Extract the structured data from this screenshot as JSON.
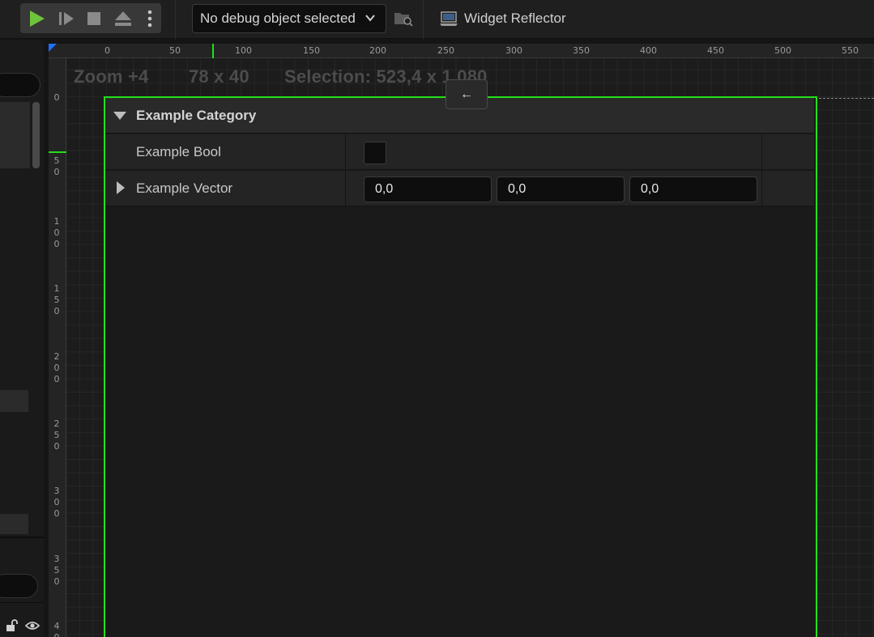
{
  "toolbar": {
    "play_icon": "play-icon",
    "step_icon": "step-forward-icon",
    "stop_icon": "stop-icon",
    "eject_icon": "eject-icon",
    "more_icon": "more-vertical-icon",
    "debug_dropdown": "No debug object selected",
    "find_icon": "find-in-browser-icon",
    "widget_reflector": "Widget Reflector",
    "play_color": "#6fc33a"
  },
  "canvas": {
    "zoom": "Zoom +4",
    "size": "78 x 40",
    "selection": "Selection: 523,4 x 1 080",
    "back_label": "←",
    "ruler_top": [
      "0",
      "50",
      "100",
      "150",
      "200",
      "250",
      "300",
      "350",
      "400",
      "450",
      "500",
      "550"
    ],
    "ruler_left": [
      [
        "0"
      ],
      [
        "5",
        "0"
      ],
      [
        "1",
        "0",
        "0"
      ],
      [
        "1",
        "5",
        "0"
      ],
      [
        "2",
        "0",
        "0"
      ],
      [
        "2",
        "5",
        "0"
      ],
      [
        "3",
        "0",
        "0"
      ],
      [
        "3",
        "5",
        "0"
      ],
      [
        "4",
        "0"
      ]
    ],
    "selection_color": "#23e01a"
  },
  "details": {
    "category": "Example Category",
    "bool_label": "Example Bool",
    "bool_value": false,
    "vector_label": "Example Vector",
    "vector_x": "0,0",
    "vector_y": "0,0",
    "vector_z": "0,0"
  },
  "left_panel": {
    "lock_icon": "lock-icon",
    "eye_icon": "eye-icon"
  }
}
